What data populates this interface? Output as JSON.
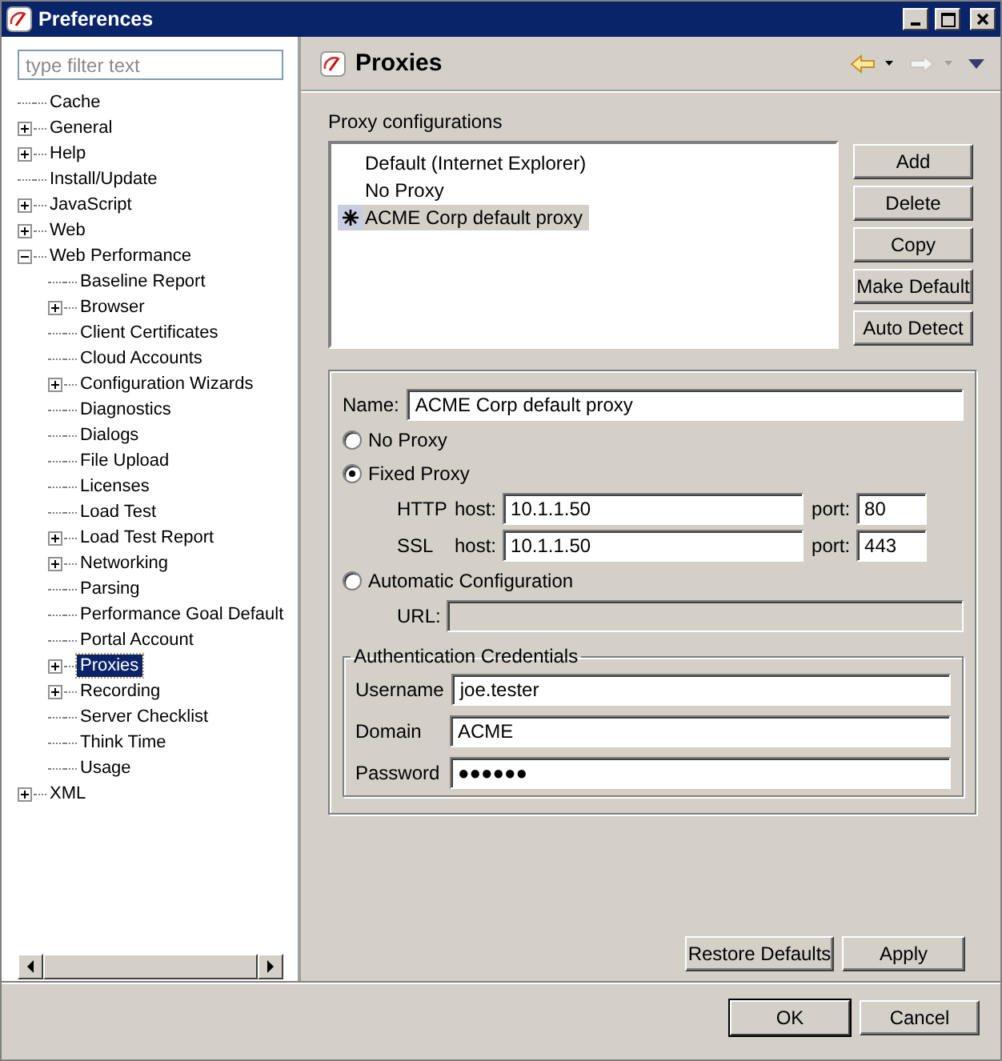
{
  "window": {
    "title": "Preferences"
  },
  "filter": {
    "placeholder": "type filter text"
  },
  "tree": [
    {
      "label": "Cache",
      "selected": false
    },
    {
      "label": "General",
      "selected": false,
      "expanded": false
    },
    {
      "label": "Help",
      "selected": false,
      "expanded": false
    },
    {
      "label": "Install/Update",
      "selected": false
    },
    {
      "label": "JavaScript",
      "selected": false,
      "expanded": false
    },
    {
      "label": "Web",
      "selected": false,
      "expanded": false
    },
    {
      "label": "Web Performance",
      "selected": false,
      "expanded": true,
      "children": [
        {
          "label": "Baseline Report",
          "selected": false
        },
        {
          "label": "Browser",
          "selected": false,
          "expanded": false
        },
        {
          "label": "Client Certificates",
          "selected": false
        },
        {
          "label": "Cloud Accounts",
          "selected": false
        },
        {
          "label": "Configuration Wizards",
          "selected": false,
          "expanded": false
        },
        {
          "label": "Diagnostics",
          "selected": false
        },
        {
          "label": "Dialogs",
          "selected": false
        },
        {
          "label": "File Upload",
          "selected": false
        },
        {
          "label": "Licenses",
          "selected": false
        },
        {
          "label": "Load Test",
          "selected": false
        },
        {
          "label": "Load Test Report",
          "selected": false,
          "expanded": false
        },
        {
          "label": "Networking",
          "selected": false,
          "expanded": false
        },
        {
          "label": "Parsing",
          "selected": false
        },
        {
          "label": "Performance Goal Default",
          "selected": false
        },
        {
          "label": "Portal Account",
          "selected": false
        },
        {
          "label": "Proxies",
          "selected": true,
          "expanded": false
        },
        {
          "label": "Recording",
          "selected": false,
          "expanded": false
        },
        {
          "label": "Server Checklist",
          "selected": false
        },
        {
          "label": "Think Time",
          "selected": false
        },
        {
          "label": "Usage",
          "selected": false
        }
      ]
    },
    {
      "label": "XML",
      "selected": false,
      "expanded": false
    }
  ],
  "page": {
    "title": "Proxies"
  },
  "proxy_configurations": {
    "label": "Proxy configurations",
    "items": [
      {
        "label": "Default (Internet Explorer)",
        "selected": false,
        "default": false
      },
      {
        "label": "No Proxy",
        "selected": false,
        "default": false
      },
      {
        "label": "ACME Corp default proxy",
        "selected": true,
        "default": true
      }
    ]
  },
  "list_buttons": [
    "Add",
    "Delete",
    "Copy",
    "Make Default",
    "Auto Detect"
  ],
  "name": {
    "label": "Name:",
    "value": "ACME Corp default proxy"
  },
  "modes": [
    {
      "label": "No Proxy",
      "selected": false
    },
    {
      "label": "Fixed Proxy",
      "selected": true,
      "rows": [
        {
          "protocol": "HTTP",
          "host_label": "host:",
          "host": "10.1.1.50",
          "port_label": "port:",
          "port": "80"
        },
        {
          "protocol": "SSL",
          "host_label": "host:",
          "host": "10.1.1.50",
          "port_label": "port:",
          "port": "443"
        }
      ]
    },
    {
      "label": "Automatic Configuration",
      "selected": false,
      "url": {
        "label": "URL:",
        "disabled": true
      }
    }
  ],
  "credentials": {
    "title": "Authentication Credentials",
    "fields": [
      {
        "label": "Username",
        "value": "joe.tester"
      },
      {
        "label": "Domain",
        "value": "ACME"
      },
      {
        "label": "Password",
        "value": "●●●●●●"
      }
    ]
  },
  "page_buttons": [
    "Restore Defaults",
    "Apply"
  ],
  "dialog_buttons": [
    {
      "label": "OK",
      "default": true
    },
    {
      "label": "Cancel",
      "default": false
    }
  ]
}
